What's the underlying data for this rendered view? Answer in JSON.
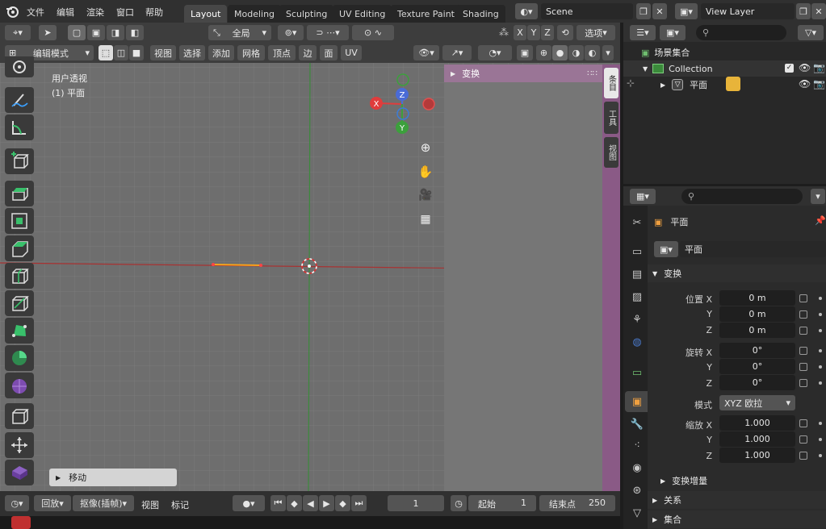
{
  "topbar": {
    "menus": [
      "文件",
      "编辑",
      "渲染",
      "窗口",
      "帮助"
    ],
    "workspaces": [
      "Layout",
      "Modeling",
      "Sculpting",
      "UV Editing",
      "Texture Paint",
      "Shading"
    ],
    "active_workspace": "Layout",
    "scene": "Scene",
    "view_layer": "View Layer"
  },
  "viewport": {
    "header1": {
      "transform_orientation": "全局",
      "axes": [
        "X",
        "Y",
        "Z"
      ],
      "options": "选项"
    },
    "header2": {
      "mode": "编辑模式",
      "menus": [
        "视图",
        "选择",
        "添加",
        "网格",
        "顶点",
        "边",
        "面",
        "UV"
      ]
    },
    "overlay_text": {
      "perspective": "用户透视",
      "object": "(1) 平面"
    },
    "npanel": {
      "title": "变换",
      "tabs": [
        "条目",
        "工具",
        "视图"
      ]
    },
    "gizmo": {
      "x": "X",
      "y": "Y",
      "z": "Z"
    },
    "last_operator": "移动"
  },
  "timeline": {
    "playback": "回放",
    "keying": "抠像(插帧)",
    "view": "视图",
    "marker": "标记",
    "current_frame": "1",
    "start_label": "起始",
    "start": "1",
    "end_label": "结束点",
    "end": "250"
  },
  "outliner": {
    "root": "场景集合",
    "collection": "Collection",
    "object": "平面"
  },
  "properties": {
    "object_name_header": "平面",
    "object_name_field": "平面",
    "section_transform": "变换",
    "location_label": "位置 X",
    "location": [
      "0 m",
      "0 m",
      "0 m"
    ],
    "rotation_label": "旋转 X",
    "rotation": [
      "0°",
      "0°",
      "0°"
    ],
    "mode_label": "模式",
    "rotation_mode": "XYZ 欧拉",
    "scale_label": "缩放 X",
    "scale": [
      "1.000",
      "1.000",
      "1.000"
    ],
    "y_label": "Y",
    "z_label": "Z",
    "delta_transform": "变换增量",
    "relations": "关系",
    "collections": "集合"
  },
  "colors": {
    "axis_x": "#e03c3c",
    "axis_y": "#3ca03c",
    "axis_z": "#4a6bd6",
    "selected": "#f7a21b",
    "viewport_bg": "#707070"
  }
}
